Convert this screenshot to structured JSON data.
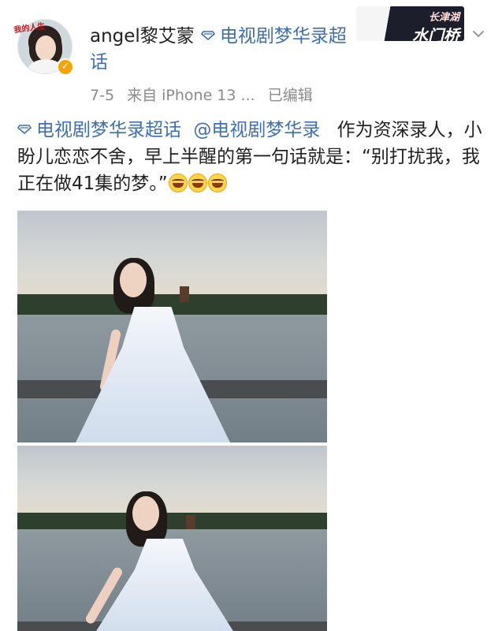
{
  "header": {
    "username": "angel黎艾蒙",
    "topic": "电视剧梦华录超话",
    "avatar_badge_text": "我的人生",
    "brand_text_top": "长津湖",
    "brand_text_bottom": "水门桥"
  },
  "meta": {
    "date": "7-5",
    "source": "来自 iPhone 13 ...",
    "edited": "已编辑"
  },
  "post": {
    "topic_link": "电视剧梦华录超话",
    "mention": "@电视剧梦华录",
    "text": "作为资深录人，小盼儿恋恋不舍，早上半醒的第一句话就是：“别打扰我，我正在做41集的梦。”",
    "emoji": "laughing-tears-emoji",
    "emoji_count": 3
  },
  "photos": [
    {
      "name": "photo-girl-lakeside-1"
    },
    {
      "name": "photo-girl-lakeside-2"
    }
  ],
  "colors": {
    "link": "#3e6fb5",
    "text": "#222222",
    "meta": "#8a8a8a",
    "verify_badge": "#f5a300"
  },
  "icons": {
    "topic": "super-topic-diamond-icon",
    "menu": "chevron-down-icon",
    "verified": "verified-badge-icon"
  }
}
